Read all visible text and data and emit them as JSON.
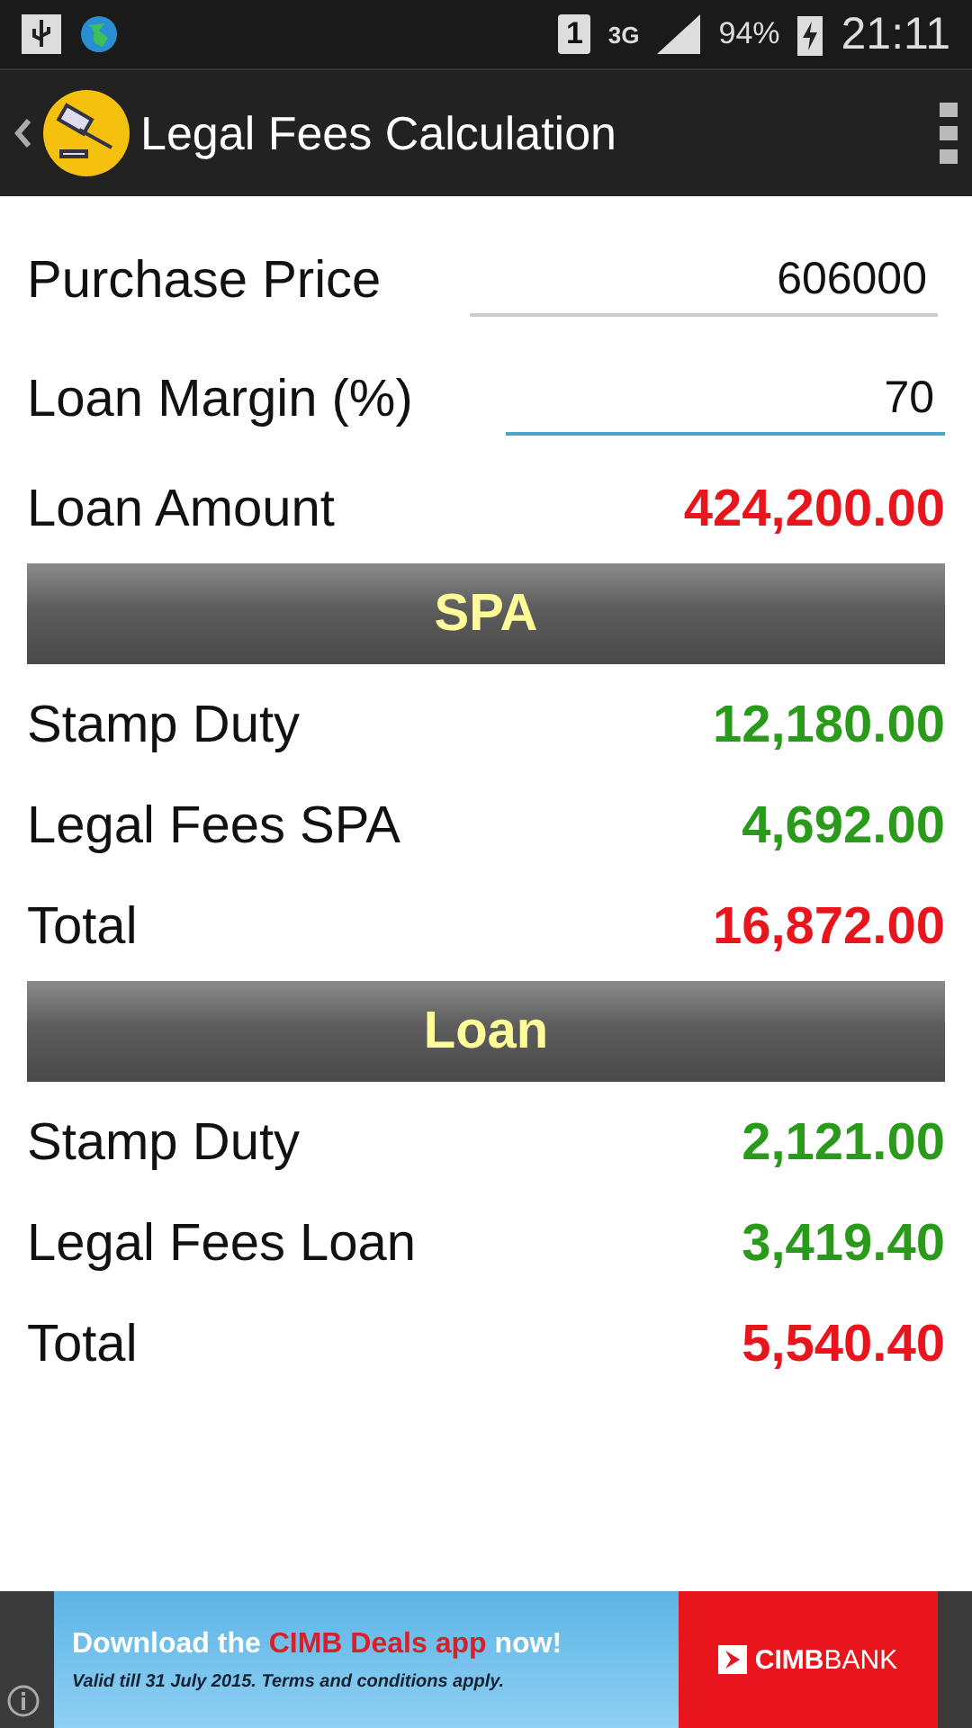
{
  "status_bar": {
    "sim": "1",
    "network": "3G",
    "battery": "94%",
    "time": "21:11"
  },
  "app_bar": {
    "title": "Legal Fees Calculation"
  },
  "inputs": [
    {
      "label": "Purchase Price",
      "value": "606000",
      "focused": false
    },
    {
      "label": "Loan Margin (%)",
      "value": "70",
      "focused": true
    }
  ],
  "loan_amount": {
    "label": "Loan Amount",
    "value": "424,200.00",
    "kind": "total"
  },
  "sections": [
    {
      "title": "SPA",
      "rows": [
        {
          "label": "Stamp Duty",
          "value": "12,180.00",
          "kind": "fee"
        },
        {
          "label": "Legal Fees SPA",
          "value": "4,692.00",
          "kind": "fee"
        },
        {
          "label": "Total",
          "value": "16,872.00",
          "kind": "total"
        }
      ]
    },
    {
      "title": "Loan",
      "rows": [
        {
          "label": "Stamp Duty",
          "value": "2,121.00",
          "kind": "fee"
        },
        {
          "label": "Legal Fees Loan",
          "value": "3,419.40",
          "kind": "fee"
        },
        {
          "label": "Total",
          "value": "5,540.40",
          "kind": "total"
        }
      ]
    }
  ],
  "ad": {
    "headline_start": "Download the",
    "headline_highlight": "CIMB Deals app",
    "headline_end": "now!",
    "fine_print": "Valid till 31 July 2015. Terms and conditions apply.",
    "brand": "CIMB",
    "brand_suffix": "BANK"
  }
}
